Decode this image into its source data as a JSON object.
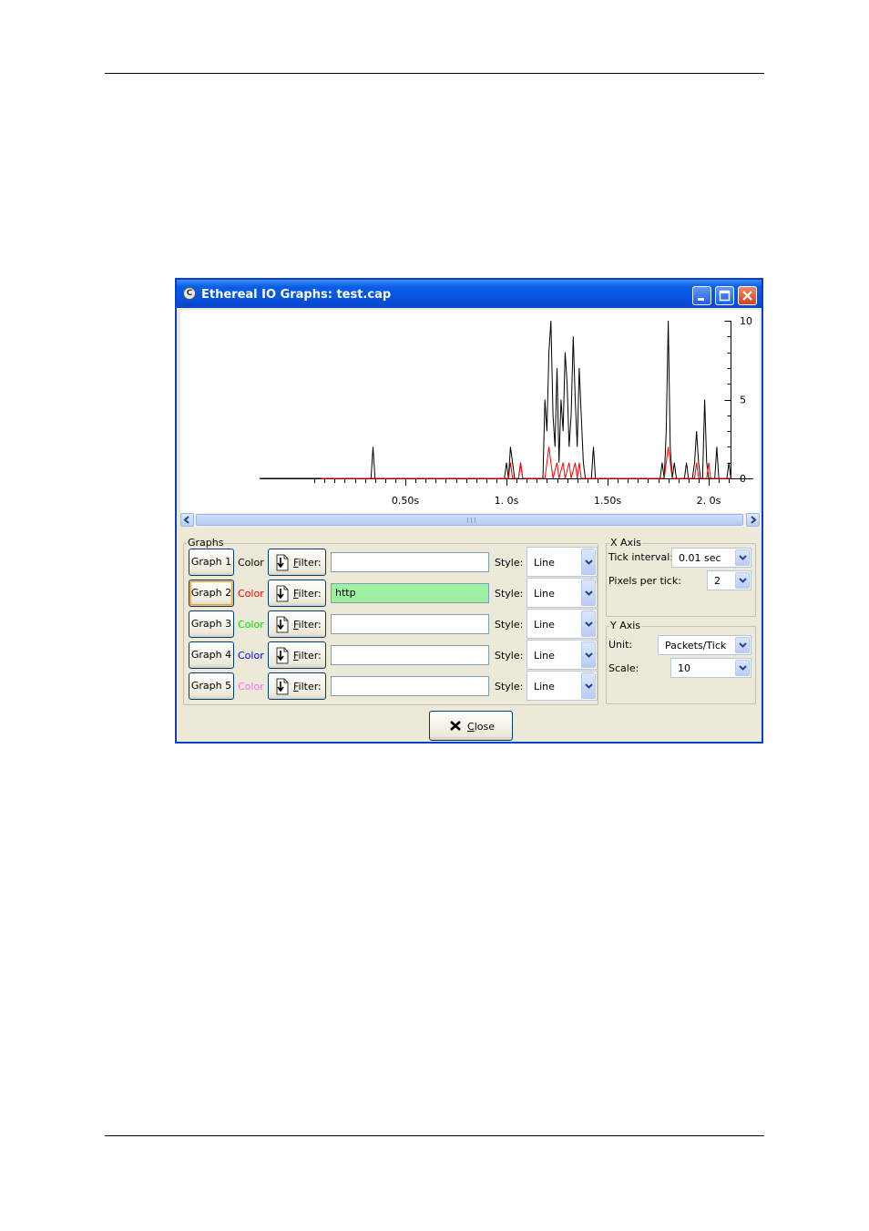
{
  "window": {
    "title": "Ethereal IO Graphs: test.cap",
    "app_icon_glyph": "C"
  },
  "chart_data": {
    "type": "line",
    "x_unit": "s",
    "x_tick_labels": [
      "0.50s",
      "1. 0s",
      "1.50s",
      "2. 0s"
    ],
    "x_tick_values": [
      0.5,
      1.0,
      1.5,
      2.0
    ],
    "y_tick_labels": [
      "10",
      "5",
      "0"
    ],
    "y_tick_values": [
      10,
      5,
      0
    ],
    "ylim": [
      0,
      10
    ],
    "xlim": [
      -0.22,
      2.22
    ],
    "series": [
      {
        "color": "#000000",
        "points": [
          [
            -0.22,
            0
          ],
          [
            0.33,
            0
          ],
          [
            0.34,
            2
          ],
          [
            0.35,
            0
          ],
          [
            0.99,
            0
          ],
          [
            1.0,
            1
          ],
          [
            1.01,
            0
          ],
          [
            1.02,
            2
          ],
          [
            1.03,
            1
          ],
          [
            1.04,
            0
          ],
          [
            1.06,
            0
          ],
          [
            1.07,
            1
          ],
          [
            1.08,
            0
          ],
          [
            1.18,
            0
          ],
          [
            1.19,
            5
          ],
          [
            1.2,
            3
          ],
          [
            1.21,
            8
          ],
          [
            1.22,
            10
          ],
          [
            1.23,
            4
          ],
          [
            1.24,
            2
          ],
          [
            1.25,
            7
          ],
          [
            1.26,
            1
          ],
          [
            1.27,
            5
          ],
          [
            1.28,
            3
          ],
          [
            1.29,
            8
          ],
          [
            1.3,
            6
          ],
          [
            1.31,
            2
          ],
          [
            1.32,
            4
          ],
          [
            1.33,
            9
          ],
          [
            1.34,
            5
          ],
          [
            1.35,
            2
          ],
          [
            1.36,
            7
          ],
          [
            1.37,
            4
          ],
          [
            1.38,
            1
          ],
          [
            1.39,
            0
          ],
          [
            1.42,
            0
          ],
          [
            1.43,
            2
          ],
          [
            1.44,
            0
          ],
          [
            1.76,
            0
          ],
          [
            1.77,
            1
          ],
          [
            1.78,
            0
          ],
          [
            1.79,
            3
          ],
          [
            1.8,
            10
          ],
          [
            1.81,
            2
          ],
          [
            1.82,
            0
          ],
          [
            1.83,
            1
          ],
          [
            1.84,
            0
          ],
          [
            1.88,
            0
          ],
          [
            1.89,
            1
          ],
          [
            1.9,
            0
          ],
          [
            1.92,
            0
          ],
          [
            1.93,
            1
          ],
          [
            1.94,
            3
          ],
          [
            1.95,
            1
          ],
          [
            1.96,
            0
          ],
          [
            1.97,
            0
          ],
          [
            1.98,
            5
          ],
          [
            1.99,
            1
          ],
          [
            2.0,
            0
          ],
          [
            2.03,
            0
          ],
          [
            2.04,
            2
          ],
          [
            2.05,
            0
          ],
          [
            2.09,
            0
          ],
          [
            2.1,
            1
          ],
          [
            2.11,
            0
          ]
        ]
      },
      {
        "color": "#ff0000",
        "points": [
          [
            0.08,
            0
          ],
          [
            1.01,
            0
          ],
          [
            1.02,
            1
          ],
          [
            1.03,
            0
          ],
          [
            1.06,
            0
          ],
          [
            1.07,
            1
          ],
          [
            1.08,
            0
          ],
          [
            1.19,
            0
          ],
          [
            1.2,
            1
          ],
          [
            1.21,
            2
          ],
          [
            1.22,
            1
          ],
          [
            1.23,
            0
          ],
          [
            1.25,
            1
          ],
          [
            1.26,
            0
          ],
          [
            1.28,
            1
          ],
          [
            1.29,
            0
          ],
          [
            1.31,
            1
          ],
          [
            1.32,
            0
          ],
          [
            1.34,
            1
          ],
          [
            1.35,
            0
          ],
          [
            1.36,
            1
          ],
          [
            1.37,
            0
          ],
          [
            1.78,
            0
          ],
          [
            1.79,
            1
          ],
          [
            1.8,
            2
          ],
          [
            1.81,
            1
          ],
          [
            1.82,
            0
          ],
          [
            1.93,
            0
          ],
          [
            1.94,
            1
          ],
          [
            1.95,
            0
          ],
          [
            1.99,
            0
          ],
          [
            2.0,
            1
          ],
          [
            2.01,
            0
          ],
          [
            2.11,
            0
          ]
        ]
      }
    ]
  },
  "graphs_frame": {
    "label": "Graphs",
    "color_label": "Color",
    "filter_label_mnemonic": "F",
    "filter_label_rest": "ilter:",
    "style_label": "Style:",
    "rows": [
      {
        "button": "Graph 1",
        "color": "#000000",
        "filter": "",
        "style": "Line",
        "filter_bg": "#ffffff",
        "pressed": false
      },
      {
        "button": "Graph 2",
        "color": "#ff0000",
        "filter": "http",
        "style": "Line",
        "filter_bg": "#9df0a0",
        "pressed": true
      },
      {
        "button": "Graph 3",
        "color": "#00e000",
        "filter": "",
        "style": "Line",
        "filter_bg": "#ffffff",
        "pressed": false
      },
      {
        "button": "Graph 4",
        "color": "#0000ff",
        "filter": "",
        "style": "Line",
        "filter_bg": "#ffffff",
        "pressed": false
      },
      {
        "button": "Graph 5",
        "color": "#ff66ff",
        "filter": "",
        "style": "Line",
        "filter_bg": "#ffffff",
        "pressed": false
      }
    ]
  },
  "x_axis_frame": {
    "label": "X Axis",
    "tick_interval_label": "Tick interval:",
    "tick_interval_value": "0.01 sec",
    "pixels_per_tick_label": "Pixels per tick:",
    "pixels_per_tick_value": "2"
  },
  "y_axis_frame": {
    "label": "Y Axis",
    "unit_label": "Unit:",
    "unit_value": "Packets/Tick",
    "scale_label": "Scale:",
    "scale_value": "10"
  },
  "close_button": {
    "mnemonic": "C",
    "rest": "lose"
  }
}
